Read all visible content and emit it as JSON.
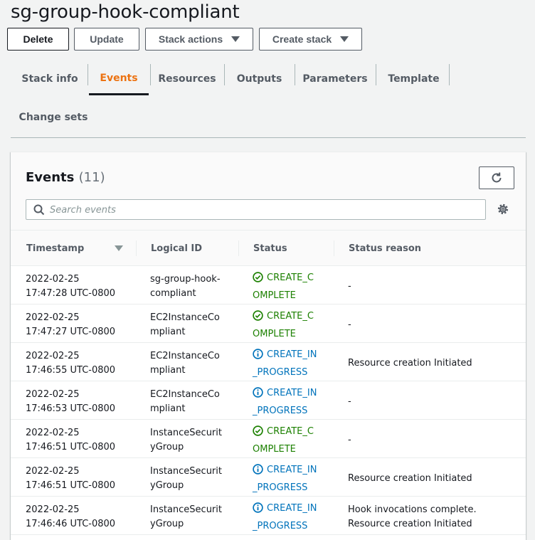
{
  "page": {
    "title": "sg-group-hook-compliant"
  },
  "actions": {
    "delete_label": "Delete",
    "update_label": "Update",
    "stack_actions_label": "Stack actions",
    "create_stack_label": "Create stack"
  },
  "tabs": [
    {
      "label": "Stack info"
    },
    {
      "label": "Events",
      "active": true
    },
    {
      "label": "Resources"
    },
    {
      "label": "Outputs"
    },
    {
      "label": "Parameters"
    },
    {
      "label": "Template"
    },
    {
      "label": "Change sets"
    }
  ],
  "events": {
    "title": "Events",
    "count": "(11)",
    "search_placeholder": "Search events",
    "columns": [
      "Timestamp",
      "Logical ID",
      "Status",
      "Status reason"
    ],
    "rows": [
      {
        "ts1": "2022-02-25",
        "ts2": "17:47:28 UTC-0800",
        "id1": "sg-group-hook-",
        "id2": "compliant",
        "st1": "CREATE_C",
        "st2": "OMPLETE",
        "kind": "ok",
        "r1": "-",
        "r2": ""
      },
      {
        "ts1": "2022-02-25",
        "ts2": "17:47:27 UTC-0800",
        "id1": "EC2InstanceCo",
        "id2": "mpliant",
        "st1": "CREATE_C",
        "st2": "OMPLETE",
        "kind": "ok",
        "r1": "-",
        "r2": ""
      },
      {
        "ts1": "2022-02-25",
        "ts2": "17:46:55 UTC-0800",
        "id1": "EC2InstanceCo",
        "id2": "mpliant",
        "st1": "CREATE_IN",
        "st2": "_PROGRESS",
        "kind": "info",
        "r1": "Resource creation Initiated",
        "r2": ""
      },
      {
        "ts1": "2022-02-25",
        "ts2": "17:46:53 UTC-0800",
        "id1": "EC2InstanceCo",
        "id2": "mpliant",
        "st1": "CREATE_IN",
        "st2": "_PROGRESS",
        "kind": "info",
        "r1": "-",
        "r2": ""
      },
      {
        "ts1": "2022-02-25",
        "ts2": "17:46:51 UTC-0800",
        "id1": "InstanceSecurit",
        "id2": "yGroup",
        "st1": "CREATE_C",
        "st2": "OMPLETE",
        "kind": "ok",
        "r1": "-",
        "r2": ""
      },
      {
        "ts1": "2022-02-25",
        "ts2": "17:46:51 UTC-0800",
        "id1": "InstanceSecurit",
        "id2": "yGroup",
        "st1": "CREATE_IN",
        "st2": "_PROGRESS",
        "kind": "info",
        "r1": "Resource creation Initiated",
        "r2": ""
      },
      {
        "ts1": "2022-02-25",
        "ts2": "17:46:46 UTC-0800",
        "id1": "InstanceSecurit",
        "id2": "yGroup",
        "st1": "CREATE_IN",
        "st2": "_PROGRESS",
        "kind": "info",
        "r1": "Hook invocations complete.",
        "r2": "Resource creation Initiated"
      }
    ]
  },
  "colors": {
    "accent": "#ec7211",
    "success": "#1d8102",
    "info": "#0073bb"
  },
  "icons": {
    "success": "check-circle-icon",
    "info": "info-circle-icon",
    "refresh": "refresh-icon",
    "search": "search-icon",
    "settings": "gear-icon"
  }
}
